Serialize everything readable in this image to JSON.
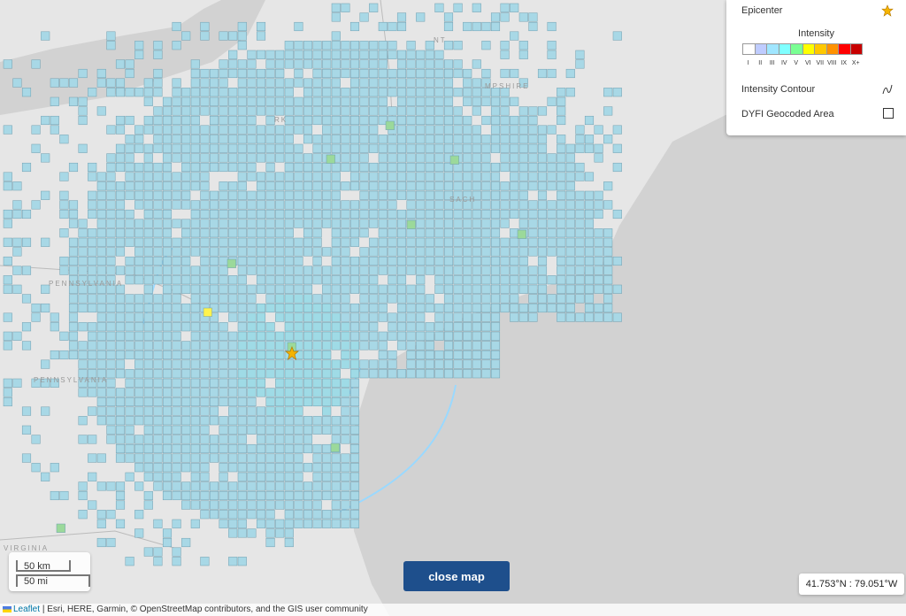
{
  "map": {
    "epicenter_icon": "star-icon",
    "place_labels": [
      "PENNSYLVANIA",
      "PENNSYLVANIA",
      "VIRGINIA",
      "NT",
      "RK",
      "MPSHIRE",
      "SACH"
    ]
  },
  "legend": {
    "epicenter_label": "Epicenter",
    "intensity_title": "Intensity",
    "intensity_ticks": [
      "I",
      "II",
      "III",
      "IV",
      "V",
      "VI",
      "VII",
      "VIII",
      "IX",
      "X+"
    ],
    "intensity_colors": [
      "#ffffff",
      "#bfccff",
      "#a0e6ff",
      "#80ffff",
      "#7aff93",
      "#ffff00",
      "#ffc800",
      "#ff9100",
      "#ff0000",
      "#c80000"
    ],
    "contour_label": "Intensity Contour",
    "geocoded_label": "DYFI Geocoded Area",
    "contour_icon": "contour-icon",
    "geocoded_icon": "square-outline-icon"
  },
  "scale": {
    "km": "50 km",
    "mi": "50 mi"
  },
  "close_button": "close map",
  "coordinates": "41.753°N : 79.051°W",
  "attribution": {
    "leaflet": "Leaflet",
    "text": "| Esri, HERE, Garmin, © OpenStreetMap contributors, and the GIS user community"
  }
}
